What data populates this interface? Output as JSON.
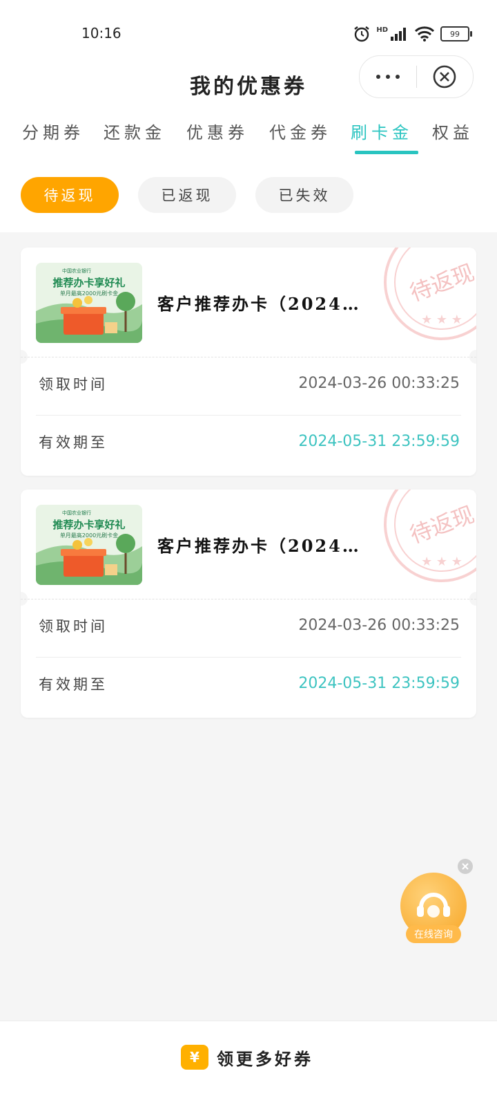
{
  "status": {
    "time": "10:16",
    "network": "HD",
    "battery": "99"
  },
  "header": {
    "title": "我的优惠券"
  },
  "tabs": [
    "分期券",
    "还款金",
    "优惠券",
    "代金券",
    "刷卡金",
    "权益"
  ],
  "active_tab": "刷卡金",
  "filters": [
    "待返现",
    "已返现",
    "已失效"
  ],
  "active_filter": "待返现",
  "coupons": [
    {
      "title": "客户推荐办卡（2024…",
      "stamp": "待返现",
      "thumb": {
        "bank": "中国农业银行",
        "headline": "推荐办卡享好礼",
        "sub": "单月最高2000元刷卡金"
      },
      "rows": [
        {
          "label": "领取时间",
          "value": "2024-03-26  00:33:25"
        },
        {
          "label": "有效期至",
          "value": "2024-05-31  23:59:59"
        }
      ]
    },
    {
      "title": "客户推荐办卡（2024…",
      "stamp": "待返现",
      "thumb": {
        "bank": "中国农业银行",
        "headline": "推荐办卡享好礼",
        "sub": "单月最高2000元刷卡金"
      },
      "rows": [
        {
          "label": "领取时间",
          "value": "2024-03-26  00:33:25"
        },
        {
          "label": "有效期至",
          "value": "2024-05-31  23:59:59"
        }
      ]
    }
  ],
  "float_button": {
    "label": "在线咨询"
  },
  "bottom": {
    "label": "领更多好券",
    "icon_text": "¥"
  },
  "colors": {
    "accent": "#29c4c0",
    "orange": "#ffa500",
    "stamp": "#f3b3b3"
  }
}
